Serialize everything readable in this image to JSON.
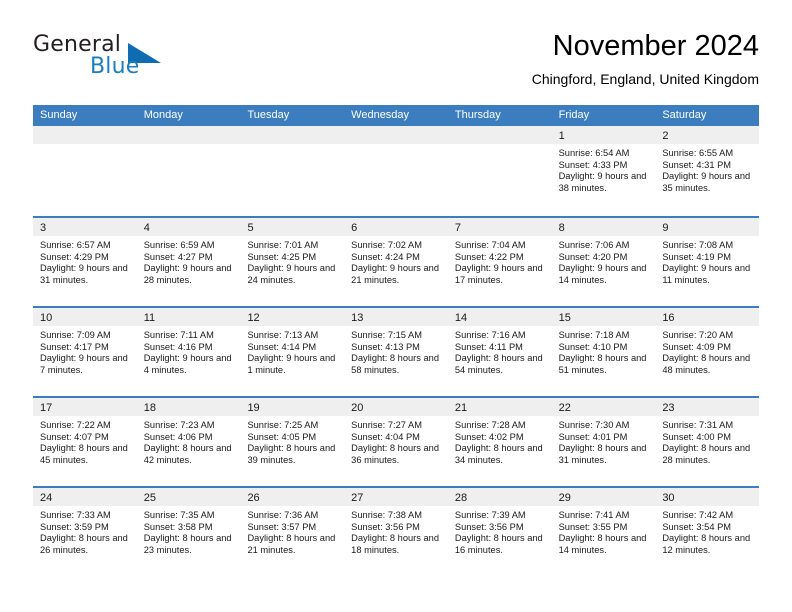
{
  "brand": {
    "word_one": "General",
    "word_two": "Blue",
    "triangle_color": "#0f6cb0",
    "blue_color": "#1a7fc1"
  },
  "header": {
    "title": "November 2024",
    "subtitle": "Chingford, England, United Kingdom"
  },
  "theme": {
    "header_bar_color": "#3b7dbf",
    "daynum_band_color": "#efefef",
    "text_color": "#1a1a1a"
  },
  "weekdays": [
    "Sunday",
    "Monday",
    "Tuesday",
    "Wednesday",
    "Thursday",
    "Friday",
    "Saturday"
  ],
  "weeks": [
    [
      {
        "day": "",
        "sunrise": "",
        "sunset": "",
        "daylight": "",
        "empty": true
      },
      {
        "day": "",
        "sunrise": "",
        "sunset": "",
        "daylight": "",
        "empty": true
      },
      {
        "day": "",
        "sunrise": "",
        "sunset": "",
        "daylight": "",
        "empty": true
      },
      {
        "day": "",
        "sunrise": "",
        "sunset": "",
        "daylight": "",
        "empty": true
      },
      {
        "day": "",
        "sunrise": "",
        "sunset": "",
        "daylight": "",
        "empty": true
      },
      {
        "day": "1",
        "sunrise": "Sunrise: 6:54 AM",
        "sunset": "Sunset: 4:33 PM",
        "daylight": "Daylight: 9 hours and 38 minutes."
      },
      {
        "day": "2",
        "sunrise": "Sunrise: 6:55 AM",
        "sunset": "Sunset: 4:31 PM",
        "daylight": "Daylight: 9 hours and 35 minutes."
      }
    ],
    [
      {
        "day": "3",
        "sunrise": "Sunrise: 6:57 AM",
        "sunset": "Sunset: 4:29 PM",
        "daylight": "Daylight: 9 hours and 31 minutes."
      },
      {
        "day": "4",
        "sunrise": "Sunrise: 6:59 AM",
        "sunset": "Sunset: 4:27 PM",
        "daylight": "Daylight: 9 hours and 28 minutes."
      },
      {
        "day": "5",
        "sunrise": "Sunrise: 7:01 AM",
        "sunset": "Sunset: 4:25 PM",
        "daylight": "Daylight: 9 hours and 24 minutes."
      },
      {
        "day": "6",
        "sunrise": "Sunrise: 7:02 AM",
        "sunset": "Sunset: 4:24 PM",
        "daylight": "Daylight: 9 hours and 21 minutes."
      },
      {
        "day": "7",
        "sunrise": "Sunrise: 7:04 AM",
        "sunset": "Sunset: 4:22 PM",
        "daylight": "Daylight: 9 hours and 17 minutes."
      },
      {
        "day": "8",
        "sunrise": "Sunrise: 7:06 AM",
        "sunset": "Sunset: 4:20 PM",
        "daylight": "Daylight: 9 hours and 14 minutes."
      },
      {
        "day": "9",
        "sunrise": "Sunrise: 7:08 AM",
        "sunset": "Sunset: 4:19 PM",
        "daylight": "Daylight: 9 hours and 11 minutes."
      }
    ],
    [
      {
        "day": "10",
        "sunrise": "Sunrise: 7:09 AM",
        "sunset": "Sunset: 4:17 PM",
        "daylight": "Daylight: 9 hours and 7 minutes."
      },
      {
        "day": "11",
        "sunrise": "Sunrise: 7:11 AM",
        "sunset": "Sunset: 4:16 PM",
        "daylight": "Daylight: 9 hours and 4 minutes."
      },
      {
        "day": "12",
        "sunrise": "Sunrise: 7:13 AM",
        "sunset": "Sunset: 4:14 PM",
        "daylight": "Daylight: 9 hours and 1 minute."
      },
      {
        "day": "13",
        "sunrise": "Sunrise: 7:15 AM",
        "sunset": "Sunset: 4:13 PM",
        "daylight": "Daylight: 8 hours and 58 minutes."
      },
      {
        "day": "14",
        "sunrise": "Sunrise: 7:16 AM",
        "sunset": "Sunset: 4:11 PM",
        "daylight": "Daylight: 8 hours and 54 minutes."
      },
      {
        "day": "15",
        "sunrise": "Sunrise: 7:18 AM",
        "sunset": "Sunset: 4:10 PM",
        "daylight": "Daylight: 8 hours and 51 minutes."
      },
      {
        "day": "16",
        "sunrise": "Sunrise: 7:20 AM",
        "sunset": "Sunset: 4:09 PM",
        "daylight": "Daylight: 8 hours and 48 minutes."
      }
    ],
    [
      {
        "day": "17",
        "sunrise": "Sunrise: 7:22 AM",
        "sunset": "Sunset: 4:07 PM",
        "daylight": "Daylight: 8 hours and 45 minutes."
      },
      {
        "day": "18",
        "sunrise": "Sunrise: 7:23 AM",
        "sunset": "Sunset: 4:06 PM",
        "daylight": "Daylight: 8 hours and 42 minutes."
      },
      {
        "day": "19",
        "sunrise": "Sunrise: 7:25 AM",
        "sunset": "Sunset: 4:05 PM",
        "daylight": "Daylight: 8 hours and 39 minutes."
      },
      {
        "day": "20",
        "sunrise": "Sunrise: 7:27 AM",
        "sunset": "Sunset: 4:04 PM",
        "daylight": "Daylight: 8 hours and 36 minutes."
      },
      {
        "day": "21",
        "sunrise": "Sunrise: 7:28 AM",
        "sunset": "Sunset: 4:02 PM",
        "daylight": "Daylight: 8 hours and 34 minutes."
      },
      {
        "day": "22",
        "sunrise": "Sunrise: 7:30 AM",
        "sunset": "Sunset: 4:01 PM",
        "daylight": "Daylight: 8 hours and 31 minutes."
      },
      {
        "day": "23",
        "sunrise": "Sunrise: 7:31 AM",
        "sunset": "Sunset: 4:00 PM",
        "daylight": "Daylight: 8 hours and 28 minutes."
      }
    ],
    [
      {
        "day": "24",
        "sunrise": "Sunrise: 7:33 AM",
        "sunset": "Sunset: 3:59 PM",
        "daylight": "Daylight: 8 hours and 26 minutes."
      },
      {
        "day": "25",
        "sunrise": "Sunrise: 7:35 AM",
        "sunset": "Sunset: 3:58 PM",
        "daylight": "Daylight: 8 hours and 23 minutes."
      },
      {
        "day": "26",
        "sunrise": "Sunrise: 7:36 AM",
        "sunset": "Sunset: 3:57 PM",
        "daylight": "Daylight: 8 hours and 21 minutes."
      },
      {
        "day": "27",
        "sunrise": "Sunrise: 7:38 AM",
        "sunset": "Sunset: 3:56 PM",
        "daylight": "Daylight: 8 hours and 18 minutes."
      },
      {
        "day": "28",
        "sunrise": "Sunrise: 7:39 AM",
        "sunset": "Sunset: 3:56 PM",
        "daylight": "Daylight: 8 hours and 16 minutes."
      },
      {
        "day": "29",
        "sunrise": "Sunrise: 7:41 AM",
        "sunset": "Sunset: 3:55 PM",
        "daylight": "Daylight: 8 hours and 14 minutes."
      },
      {
        "day": "30",
        "sunrise": "Sunrise: 7:42 AM",
        "sunset": "Sunset: 3:54 PM",
        "daylight": "Daylight: 8 hours and 12 minutes."
      }
    ]
  ]
}
